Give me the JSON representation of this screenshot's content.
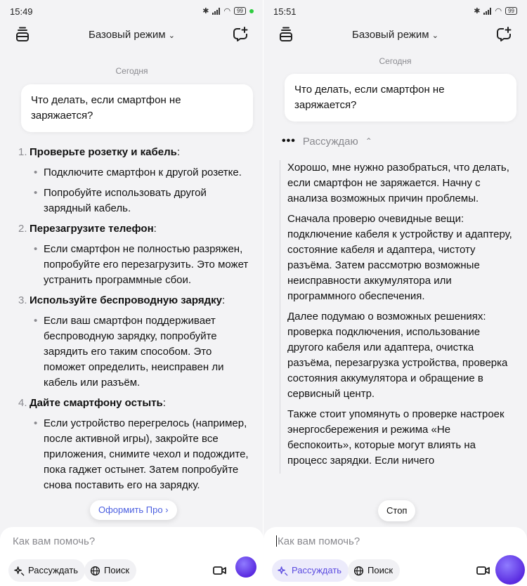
{
  "screens": [
    {
      "status": {
        "time": "15:49",
        "battery": "99"
      },
      "header": {
        "mode": "Базовый режим"
      },
      "date": "Сегодня",
      "question": "Что делать, если смартфон не заряжается?",
      "answer": [
        {
          "num": "1.",
          "title": "Проверьте розетку и кабель",
          "bullets": [
            "Подключите смартфон к другой розетке.",
            "Попробуйте использовать другой зарядный кабель."
          ]
        },
        {
          "num": "2.",
          "title": "Перезагрузите телефон",
          "bullets": [
            "Если смартфон не полностью разряжен, попробуйте его перезагрузить. Это может устранить программные сбои."
          ]
        },
        {
          "num": "3.",
          "title": "Используйте беспроводную зарядку",
          "bullets": [
            "Если ваш смартфон поддерживает беспроводную зарядку, попробуйте зарядить его таким способом. Это поможет определить, неисправен ли кабель или разъём."
          ]
        },
        {
          "num": "4.",
          "title": "Дайте смартфону остыть",
          "bullets": [
            "Если устройство перегрелось (например, после активной игры), закройте все приложения, снимите чехол и подождите, пока гаджет остынет. Затем попробуйте снова поставить его на зарядку."
          ]
        }
      ],
      "pro_button": "Оформить Про ›",
      "input": {
        "placeholder": "Как вам помочь?",
        "chip_reason": "Рассуждать",
        "chip_search": "Поиск"
      }
    },
    {
      "status": {
        "time": "15:51",
        "battery": "99"
      },
      "header": {
        "mode": "Базовый режим"
      },
      "date": "Сегодня",
      "question": "Что делать, если смартфон не заряжается?",
      "reasoning_label": "Рассуждаю",
      "reasoning": [
        "Хорошо, мне нужно разобраться, что делать, если смартфон не заряжается. Начну с анализа возможных причин проблемы.",
        "Сначала проверю очевидные вещи: подключение кабеля к устройству и адаптеру, состояние кабеля и адаптера, чистоту разъёма. Затем рассмотрю возможные неисправности аккумулятора или программного обеспечения.",
        "Далее подумаю о возможных решениях: проверка подключения, использование другого кабеля или адаптера, очистка разъёма, перезагрузка устройства, проверка состояния аккумулятора и обращение в сервисный центр.",
        "Также стоит упомянуть о проверке настроек энергосбережения и режима «Не беспокоить», которые могут влиять на процесс зарядки. Если ничего"
      ],
      "stop_button": "Стоп",
      "input": {
        "placeholder": "Как вам помочь?",
        "chip_reason": "Рассуждать",
        "chip_search": "Поиск"
      }
    }
  ],
  "colors": {
    "accent": "#5b4be0",
    "muted": "#8a8a8f",
    "background": "#f3f3f5"
  }
}
